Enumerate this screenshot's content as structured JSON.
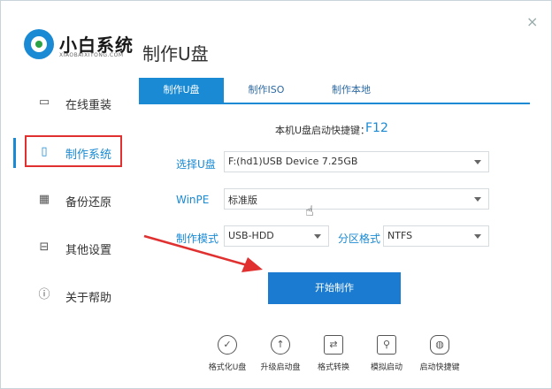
{
  "app": {
    "brand": "小白系统",
    "brand_sub": "XIAOBAIXITONG.COM",
    "page_title": "制作U盘",
    "close_symbol": "×"
  },
  "sidebar": {
    "items": [
      {
        "label": "在线重装",
        "icon": "monitor-icon",
        "glyph": "▭"
      },
      {
        "label": "制作系统",
        "icon": "usb-icon",
        "glyph": "▯"
      },
      {
        "label": "备份还原",
        "icon": "grid-icon",
        "glyph": "▦"
      },
      {
        "label": "其他设置",
        "icon": "box-icon",
        "glyph": "⊟"
      },
      {
        "label": "关于帮助",
        "icon": "info-icon",
        "glyph": "ⓘ"
      }
    ],
    "active_index": 1
  },
  "tabs": [
    {
      "label": "制作U盘"
    },
    {
      "label": "制作ISO"
    },
    {
      "label": "制作本地"
    }
  ],
  "hotkey": {
    "text": "本机U盘启动快捷键：",
    "key": "F12"
  },
  "form": {
    "usb_label": "选择U盘",
    "usb_value": "F:(hd1)USB Device 7.25GB",
    "winpe_label": "WinPE",
    "winpe_value": "标准版",
    "mode_label": "制作模式",
    "mode_value": "USB-HDD",
    "partition_label": "分区格式",
    "partition_value": "NTFS"
  },
  "start_button": "开始制作",
  "tools": [
    {
      "label": "格式化U盘",
      "icon": "check-circle-icon",
      "glyph": "✓"
    },
    {
      "label": "升级启动盘",
      "icon": "upload-icon",
      "glyph": "↑"
    },
    {
      "label": "格式转换",
      "icon": "convert-icon",
      "glyph": "⇄"
    },
    {
      "label": "模拟启动",
      "icon": "user-sim-icon",
      "glyph": "⚲"
    },
    {
      "label": "启动快捷键",
      "icon": "mouse-icon",
      "glyph": "◍"
    }
  ],
  "colors": {
    "accent": "#1a8ad4",
    "highlight_box": "#e03030",
    "annotation_arrow": "#e03030"
  }
}
